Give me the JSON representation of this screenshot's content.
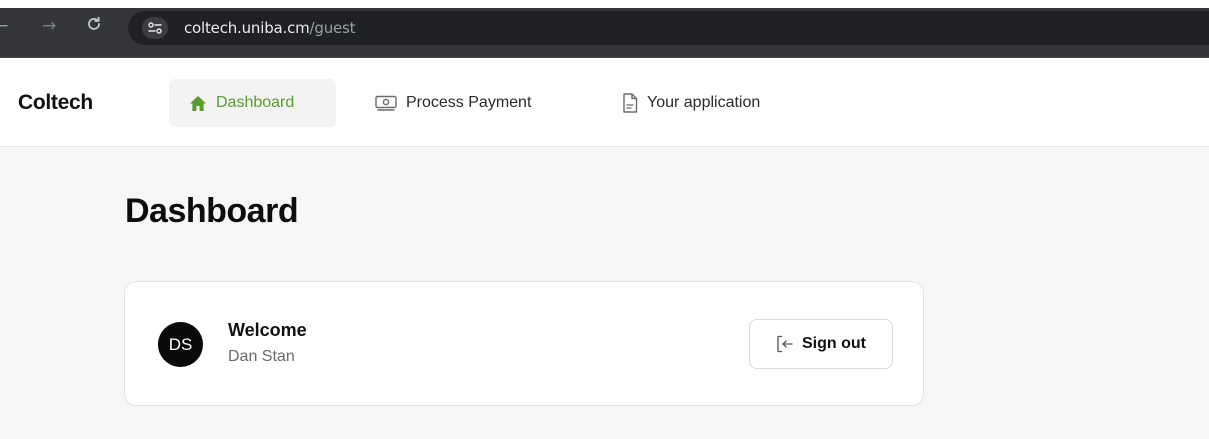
{
  "browser": {
    "url_host": "coltech.uniba.cm",
    "url_path": "/guest",
    "back_glyph": "←",
    "forward_glyph": "→",
    "icons": [
      "back-arrow-icon",
      "forward-arrow-icon",
      "reload-icon",
      "site-info-icon"
    ]
  },
  "header": {
    "brand": "Coltech",
    "nav": [
      {
        "label": "Dashboard",
        "icon": "home-icon",
        "active": true
      },
      {
        "label": "Process Payment",
        "icon": "banknote-icon",
        "active": false
      },
      {
        "label": "Your application",
        "icon": "document-icon",
        "active": false
      }
    ]
  },
  "main": {
    "title": "Dashboard",
    "card": {
      "avatar_initials": "DS",
      "welcome": "Welcome",
      "user_name": "Dan Stan",
      "signout_label": "Sign out",
      "signout_icon": "sign-out-icon"
    }
  },
  "colors": {
    "accent": "#5a9a2f",
    "browser_bar": "#35363a",
    "omnibox": "#202124"
  }
}
